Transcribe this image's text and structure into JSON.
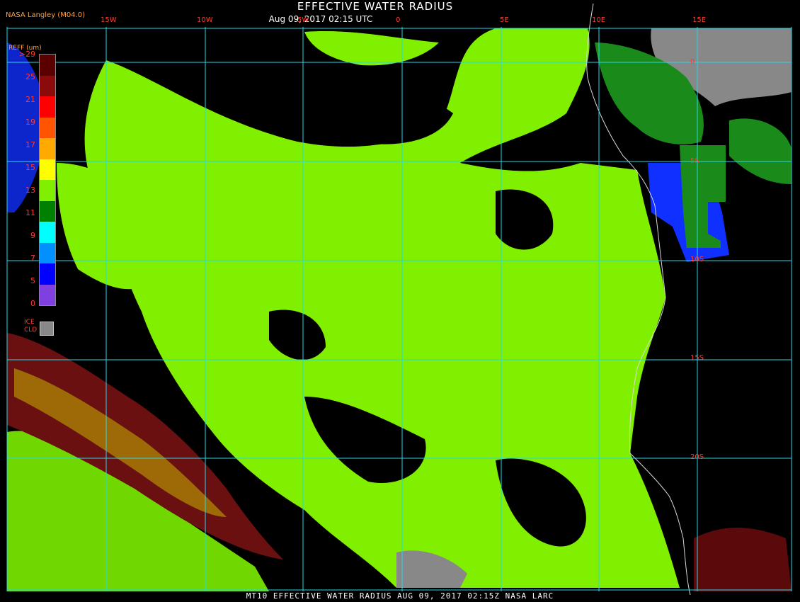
{
  "header": {
    "title": "EFFECTIVE WATER RADIUS",
    "subtitle": "Aug 09, 2017 02:15 UTC",
    "credit": "NASA Langley (M04.0)"
  },
  "footer": {
    "text": "MT10  EFFECTIVE WATER RADIUS   AUG 09, 2017 02:15Z   NASA LARC"
  },
  "map": {
    "longitude_labels": [
      "15W",
      "10W",
      "5W",
      "0",
      "5E",
      "10E",
      "15E"
    ],
    "latitude_labels": [
      "0",
      "5S",
      "10S",
      "15S",
      "20S"
    ],
    "colors": {
      "background": "#000000",
      "grid": "#2ad6e8",
      "coast": "#d8d8d8",
      "cloud_main": "#80f000",
      "ice_cloud": "#888888"
    }
  },
  "legend": {
    "title": "REFF (um)",
    "ticks": [
      ">29",
      "25",
      "21",
      "19",
      "17",
      "15",
      "13",
      "11",
      "9",
      "7",
      "5",
      "0"
    ],
    "colors": [
      "#5a0000",
      "#8b0a0a",
      "#ff0000",
      "#ff5500",
      "#ffaa00",
      "#ffff00",
      "#80f000",
      "#008000",
      "#00ffff",
      "#0090ff",
      "#0000ff",
      "#8040e0"
    ],
    "ice_label_1": "ICE",
    "ice_label_2": "CLD",
    "ice_color": "#888888"
  }
}
